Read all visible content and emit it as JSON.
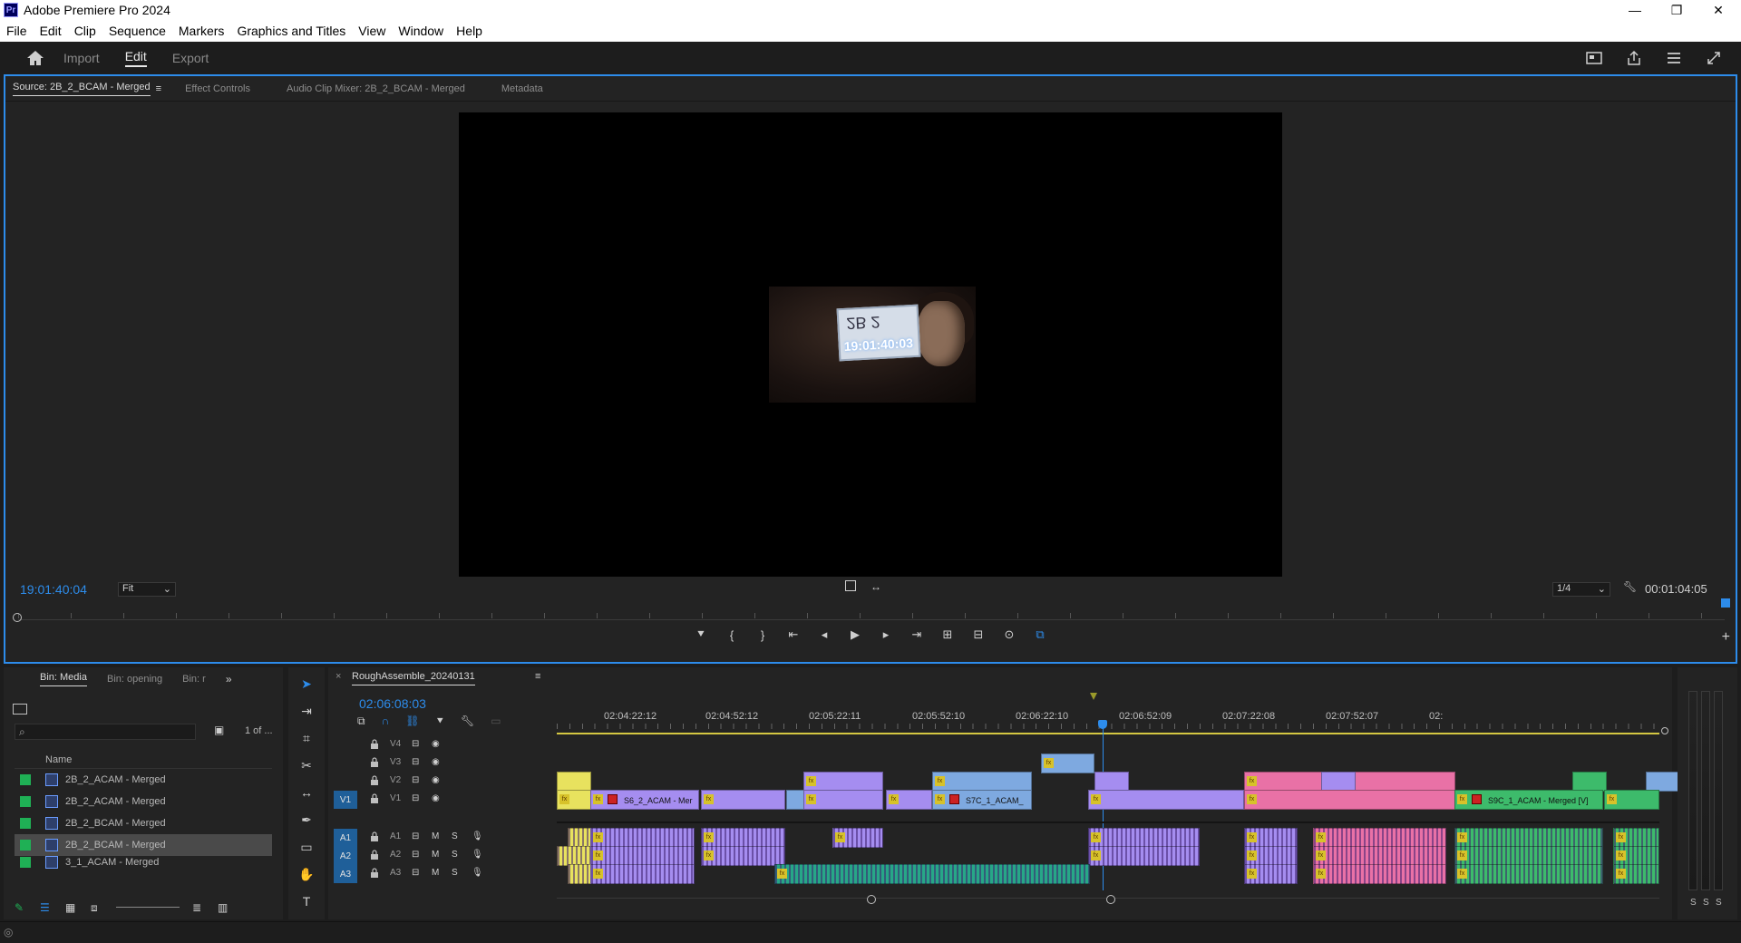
{
  "window": {
    "title": "Adobe Premiere Pro 2024",
    "app_icon": "Pr",
    "controls": [
      "—",
      "❐",
      "✕"
    ]
  },
  "menu": [
    "File",
    "Edit",
    "Clip",
    "Sequence",
    "Markers",
    "Graphics and Titles",
    "View",
    "Window",
    "Help"
  ],
  "workspace": {
    "tabs": [
      {
        "label": "Import",
        "active": false
      },
      {
        "label": "Edit",
        "active": true
      },
      {
        "label": "Export",
        "active": false
      }
    ]
  },
  "source_panel": {
    "tabs": [
      {
        "label": "Source: 2B_2_BCAM - Merged",
        "active": true
      },
      {
        "label": "Effect Controls",
        "active": false
      },
      {
        "label": "Audio Clip Mixer: 2B_2_BCAM - Merged",
        "active": false
      },
      {
        "label": "Metadata",
        "active": false
      }
    ],
    "slate_number": "2B 2",
    "slate_timecode": "19:01:40:03",
    "timecode": "19:01:40:04",
    "zoom": "Fit",
    "resolution": "1/4",
    "duration": "00:01:04:05"
  },
  "project_panel": {
    "tabs": [
      {
        "label": "Bin: Media",
        "active": true
      },
      {
        "label": "Bin: opening",
        "active": false
      },
      {
        "label": "Bin: r",
        "active": false
      }
    ],
    "count": "1 of ...",
    "column_name": "Name",
    "items": [
      {
        "name": "2B_2_ACAM - Merged",
        "selected": false
      },
      {
        "name": "2B_2_ACAM - Merged",
        "selected": false
      },
      {
        "name": "2B_2_BCAM - Merged",
        "selected": false
      },
      {
        "name": "2B_2_BCAM - Merged",
        "selected": true
      },
      {
        "name": "3_1_ACAM - Merged",
        "selected": false
      }
    ]
  },
  "timeline": {
    "sequence_name": "RoughAssemble_20240131",
    "timecode": "02:06:08:03",
    "ruler_labels": [
      "02:04:22:12",
      "02:04:52:12",
      "02:05:22:11",
      "02:05:52:10",
      "02:06:22:10",
      "02:06:52:09",
      "02:07:22:08",
      "02:07:52:07",
      "02:"
    ],
    "video_tracks": [
      {
        "label": "V4",
        "target": ""
      },
      {
        "label": "V3",
        "target": ""
      },
      {
        "label": "V2",
        "target": ""
      },
      {
        "label": "V1",
        "target": "V1"
      }
    ],
    "audio_tracks": [
      {
        "label": "A1",
        "target": "A1",
        "m": "M",
        "s": "S"
      },
      {
        "label": "A2",
        "target": "A2",
        "m": "M",
        "s": "S"
      },
      {
        "label": "A3",
        "target": "A3",
        "m": "M",
        "s": "S"
      }
    ],
    "clip_names": {
      "v1_a": "S6_2_ACAM - Mer",
      "v1_b": "S7C_1_ACAM_",
      "v1_c": "S9C_1_ACAM - Merged [V]"
    },
    "colors": {
      "violet": "#a58df0",
      "blue": "#7ea9e0",
      "pink": "#e971a6",
      "green": "#3dbb6b",
      "yellow": "#e8e25e",
      "teal": "#27a787"
    }
  },
  "audio_meter": {
    "solo_labels": [
      "S",
      "S",
      "S"
    ]
  }
}
